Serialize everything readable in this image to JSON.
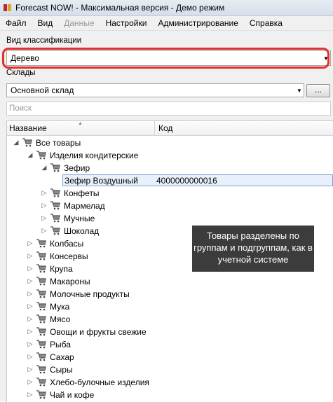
{
  "window": {
    "title": "Forecast NOW! - Максимальная версия - Демо режим"
  },
  "menu": [
    {
      "label": "Файл",
      "enabled": true
    },
    {
      "label": "Вид",
      "enabled": true
    },
    {
      "label": "Данные",
      "enabled": false
    },
    {
      "label": "Настройки",
      "enabled": true
    },
    {
      "label": "Администрирование",
      "enabled": true
    },
    {
      "label": "Справка",
      "enabled": true
    }
  ],
  "classification": {
    "label": "Вид классификации",
    "value": "Дерево"
  },
  "warehouses": {
    "label": "Склады",
    "value": "Основной склад",
    "browse_label": "..."
  },
  "search": {
    "placeholder": "Поиск"
  },
  "grid": {
    "columns": {
      "name": "Название",
      "code": "Код"
    },
    "rows": [
      {
        "level": 0,
        "expanded": true,
        "label": "Все товары",
        "code": "",
        "selected": false,
        "has_icon": true
      },
      {
        "level": 1,
        "expanded": true,
        "label": "Изделия кондитерские",
        "code": "",
        "selected": false,
        "has_icon": true
      },
      {
        "level": 2,
        "expanded": true,
        "label": "Зефир",
        "code": "",
        "selected": false,
        "has_icon": true
      },
      {
        "level": 3,
        "expanded": null,
        "label": "Зефир Воздушный",
        "code": "4000000000016",
        "selected": true,
        "has_icon": false
      },
      {
        "level": 2,
        "expanded": false,
        "label": "Конфеты",
        "code": "",
        "selected": false,
        "has_icon": true
      },
      {
        "level": 2,
        "expanded": false,
        "label": "Мармелад",
        "code": "",
        "selected": false,
        "has_icon": true
      },
      {
        "level": 2,
        "expanded": false,
        "label": "Мучные",
        "code": "",
        "selected": false,
        "has_icon": true
      },
      {
        "level": 2,
        "expanded": false,
        "label": "Шоколад",
        "code": "",
        "selected": false,
        "has_icon": true
      },
      {
        "level": 1,
        "expanded": false,
        "label": "Колбасы",
        "code": "",
        "selected": false,
        "has_icon": true
      },
      {
        "level": 1,
        "expanded": false,
        "label": "Консервы",
        "code": "",
        "selected": false,
        "has_icon": true
      },
      {
        "level": 1,
        "expanded": false,
        "label": "Крупа",
        "code": "",
        "selected": false,
        "has_icon": true
      },
      {
        "level": 1,
        "expanded": false,
        "label": "Макароны",
        "code": "",
        "selected": false,
        "has_icon": true
      },
      {
        "level": 1,
        "expanded": false,
        "label": "Молочные продукты",
        "code": "",
        "selected": false,
        "has_icon": true
      },
      {
        "level": 1,
        "expanded": false,
        "label": "Мука",
        "code": "",
        "selected": false,
        "has_icon": true
      },
      {
        "level": 1,
        "expanded": false,
        "label": "Мясо",
        "code": "",
        "selected": false,
        "has_icon": true
      },
      {
        "level": 1,
        "expanded": false,
        "label": "Овощи и фрукты свежие",
        "code": "",
        "selected": false,
        "has_icon": true
      },
      {
        "level": 1,
        "expanded": false,
        "label": "Рыба",
        "code": "",
        "selected": false,
        "has_icon": true
      },
      {
        "level": 1,
        "expanded": false,
        "label": "Сахар",
        "code": "",
        "selected": false,
        "has_icon": true
      },
      {
        "level": 1,
        "expanded": false,
        "label": "Сыры",
        "code": "",
        "selected": false,
        "has_icon": true
      },
      {
        "level": 1,
        "expanded": false,
        "label": "Хлебо-булочные изделия",
        "code": "",
        "selected": false,
        "has_icon": true
      },
      {
        "level": 1,
        "expanded": false,
        "label": "Чай и кофе",
        "code": "",
        "selected": false,
        "has_icon": true
      }
    ]
  },
  "callout": {
    "text": "Товары разделены по группам и подгруппам, как в учетной системе"
  },
  "colors": {
    "highlight": "#e0302e",
    "callout_bg": "#3c3c3c",
    "selection_border": "#7da2ce"
  },
  "icons": {
    "row_icon": "shopping-cart-icon",
    "expanded": "triangle-down-icon",
    "collapsed": "triangle-right-icon"
  }
}
